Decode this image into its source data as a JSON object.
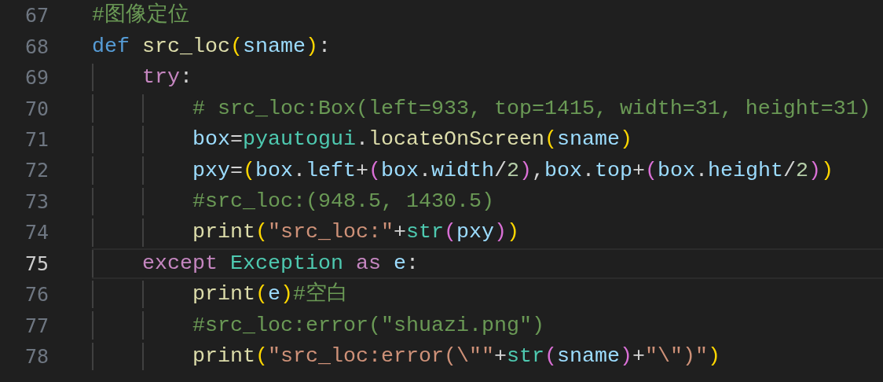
{
  "editor": {
    "lines": [
      {
        "number": "67",
        "current": false,
        "tokens": [
          {
            "text": "#图像定位",
            "kind": "comment"
          }
        ]
      },
      {
        "number": "68",
        "current": false,
        "tokens": [
          {
            "text": "def ",
            "kind": "storage"
          },
          {
            "text": "src_loc",
            "kind": "function"
          },
          {
            "text": "(",
            "kind": "bracket1"
          },
          {
            "text": "sname",
            "kind": "variable"
          },
          {
            "text": ")",
            "kind": "bracket1"
          },
          {
            "text": ":",
            "kind": "plain"
          }
        ],
        "children": [
          {
            "number": "69",
            "current": false,
            "tokens": [
              {
                "text": "try",
                "kind": "control"
              },
              {
                "text": ":",
                "kind": "plain"
              }
            ],
            "children": [
              {
                "number": "70",
                "current": false,
                "tokens": [
                  {
                    "text": "# src_loc:Box(left=933, top=1415, width=31, height=31)",
                    "kind": "comment"
                  }
                ]
              },
              {
                "number": "71",
                "current": false,
                "tokens": [
                  {
                    "text": "box",
                    "kind": "variable"
                  },
                  {
                    "text": "=",
                    "kind": "plain"
                  },
                  {
                    "text": "pyautogui",
                    "kind": "module"
                  },
                  {
                    "text": ".",
                    "kind": "plain"
                  },
                  {
                    "text": "locateOnScreen",
                    "kind": "function"
                  },
                  {
                    "text": "(",
                    "kind": "bracket1"
                  },
                  {
                    "text": "sname",
                    "kind": "variable"
                  },
                  {
                    "text": ")",
                    "kind": "bracket1"
                  }
                ]
              },
              {
                "number": "72",
                "current": false,
                "tokens": [
                  {
                    "text": "pxy",
                    "kind": "variable"
                  },
                  {
                    "text": "=",
                    "kind": "plain"
                  },
                  {
                    "text": "(",
                    "kind": "bracket1"
                  },
                  {
                    "text": "box",
                    "kind": "variable"
                  },
                  {
                    "text": ".",
                    "kind": "plain"
                  },
                  {
                    "text": "left",
                    "kind": "variable"
                  },
                  {
                    "text": "+",
                    "kind": "plain"
                  },
                  {
                    "text": "(",
                    "kind": "bracket2"
                  },
                  {
                    "text": "box",
                    "kind": "variable"
                  },
                  {
                    "text": ".",
                    "kind": "plain"
                  },
                  {
                    "text": "width",
                    "kind": "variable"
                  },
                  {
                    "text": "/",
                    "kind": "plain"
                  },
                  {
                    "text": "2",
                    "kind": "number"
                  },
                  {
                    "text": ")",
                    "kind": "bracket2"
                  },
                  {
                    "text": ",",
                    "kind": "plain"
                  },
                  {
                    "text": "box",
                    "kind": "variable"
                  },
                  {
                    "text": ".",
                    "kind": "plain"
                  },
                  {
                    "text": "top",
                    "kind": "variable"
                  },
                  {
                    "text": "+",
                    "kind": "plain"
                  },
                  {
                    "text": "(",
                    "kind": "bracket2"
                  },
                  {
                    "text": "box",
                    "kind": "variable"
                  },
                  {
                    "text": ".",
                    "kind": "plain"
                  },
                  {
                    "text": "height",
                    "kind": "variable"
                  },
                  {
                    "text": "/",
                    "kind": "plain"
                  },
                  {
                    "text": "2",
                    "kind": "number"
                  },
                  {
                    "text": ")",
                    "kind": "bracket2"
                  },
                  {
                    "text": ")",
                    "kind": "bracket1"
                  }
                ]
              },
              {
                "number": "73",
                "current": false,
                "tokens": [
                  {
                    "text": "#src_loc:(948.5, 1430.5)",
                    "kind": "comment"
                  }
                ]
              },
              {
                "number": "74",
                "current": false,
                "tokens": [
                  {
                    "text": "print",
                    "kind": "function"
                  },
                  {
                    "text": "(",
                    "kind": "bracket1"
                  },
                  {
                    "text": "\"src_loc:\"",
                    "kind": "string"
                  },
                  {
                    "text": "+",
                    "kind": "plain"
                  },
                  {
                    "text": "str",
                    "kind": "module"
                  },
                  {
                    "text": "(",
                    "kind": "bracket2"
                  },
                  {
                    "text": "pxy",
                    "kind": "variable"
                  },
                  {
                    "text": ")",
                    "kind": "bracket2"
                  },
                  {
                    "text": ")",
                    "kind": "bracket1"
                  }
                ]
              }
            ]
          },
          {
            "number": "75",
            "current": true,
            "tokens": [
              {
                "text": "except ",
                "kind": "control"
              },
              {
                "text": "Exception ",
                "kind": "module"
              },
              {
                "text": "as ",
                "kind": "control"
              },
              {
                "text": "e",
                "kind": "variable"
              },
              {
                "text": ":",
                "kind": "plain"
              }
            ],
            "children": [
              {
                "number": "76",
                "current": false,
                "tokens": [
                  {
                    "text": "print",
                    "kind": "function"
                  },
                  {
                    "text": "(",
                    "kind": "bracket1"
                  },
                  {
                    "text": "e",
                    "kind": "variable"
                  },
                  {
                    "text": ")",
                    "kind": "bracket1"
                  },
                  {
                    "text": "#空白",
                    "kind": "comment"
                  }
                ]
              },
              {
                "number": "77",
                "current": false,
                "tokens": [
                  {
                    "text": "#src_loc:error(\"shuazi.png\")",
                    "kind": "comment"
                  }
                ]
              },
              {
                "number": "78",
                "current": false,
                "tokens": [
                  {
                    "text": "print",
                    "kind": "function"
                  },
                  {
                    "text": "(",
                    "kind": "bracket1"
                  },
                  {
                    "text": "\"src_loc:error(\\\"\"",
                    "kind": "string"
                  },
                  {
                    "text": "+",
                    "kind": "plain"
                  },
                  {
                    "text": "str",
                    "kind": "module"
                  },
                  {
                    "text": "(",
                    "kind": "bracket2"
                  },
                  {
                    "text": "sname",
                    "kind": "variable"
                  },
                  {
                    "text": ")",
                    "kind": "bracket2"
                  },
                  {
                    "text": "+",
                    "kind": "plain"
                  },
                  {
                    "text": "\"\\\")\"",
                    "kind": "string"
                  },
                  {
                    "text": ")",
                    "kind": "bracket1"
                  }
                ]
              }
            ]
          }
        ]
      }
    ]
  }
}
